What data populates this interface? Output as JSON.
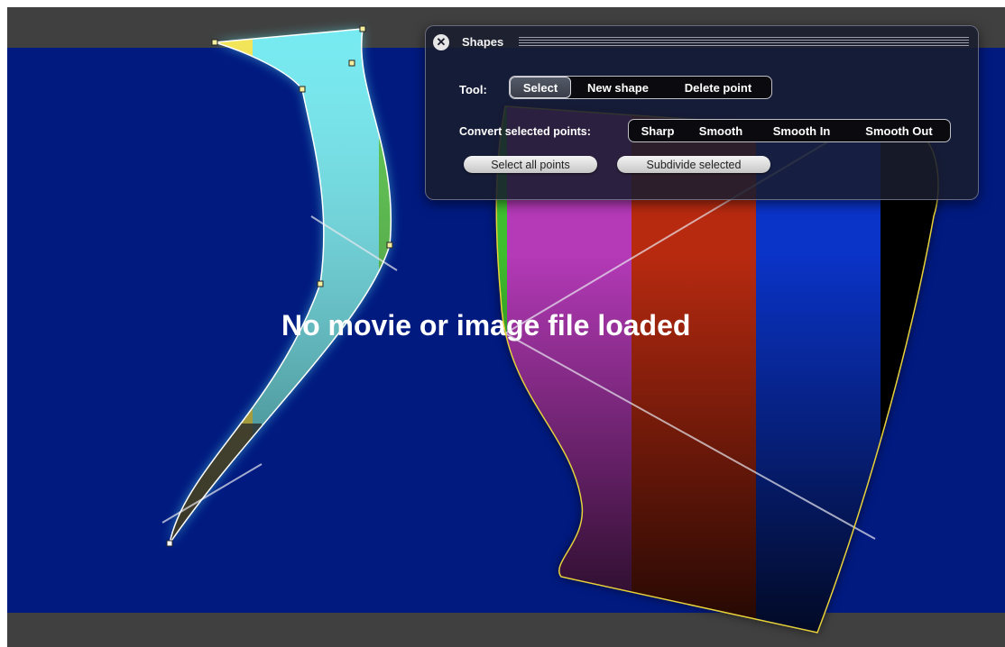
{
  "panel": {
    "title": "Shapes",
    "close_icon": "close-icon",
    "tool_label": "Tool:",
    "tools": [
      {
        "label": "Select",
        "active": true
      },
      {
        "label": "New shape",
        "active": false
      },
      {
        "label": "Delete point",
        "active": false
      }
    ],
    "convert_label": "Convert selected points:",
    "convert_options": [
      {
        "label": "Sharp"
      },
      {
        "label": "Smooth"
      },
      {
        "label": "Smooth In"
      },
      {
        "label": "Smooth Out"
      }
    ],
    "select_all_label": "Select all points",
    "subdivide_label": "Subdivide selected"
  },
  "canvas": {
    "message": "No movie or image file loaded",
    "background_color": "#001a80",
    "stripe_colors": [
      "#f2e23a",
      "#5ee8f0",
      "#3fbf2e",
      "#b53ab8",
      "#b82a10",
      "#0a33c8",
      "#000000"
    ]
  },
  "colors": {
    "chrome": "#404040",
    "selected_shape_stroke": "#ffffff",
    "other_shape_stroke": "#e8d23a",
    "control_point": "#f5f0a0"
  }
}
